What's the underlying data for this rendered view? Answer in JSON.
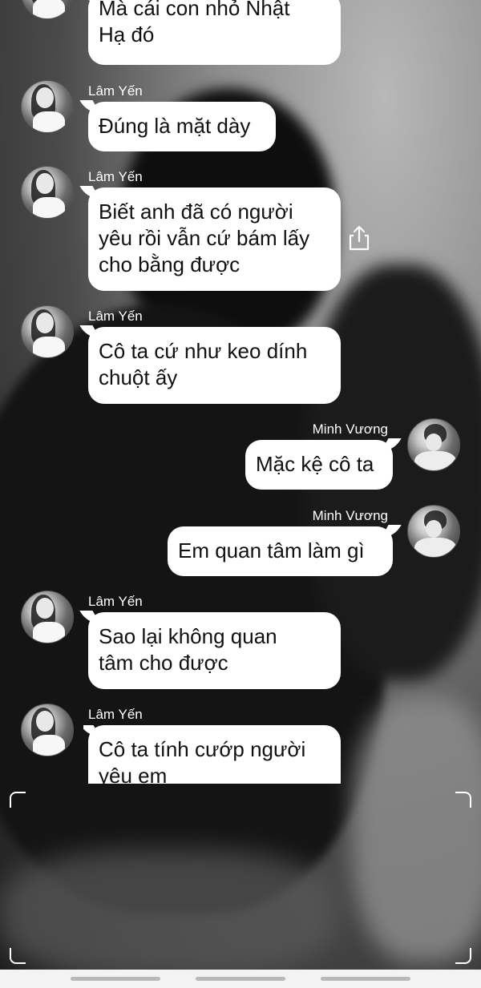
{
  "chat": {
    "messages": [
      {
        "sender": "",
        "side": "left",
        "text": "Mà cái con nhỏ Nhật\nHạ đó"
      },
      {
        "sender": "Lâm Yến",
        "side": "left",
        "text": "Đúng là mặt dày"
      },
      {
        "sender": "Lâm Yến",
        "side": "left",
        "text": "Biết anh đã có người\nyêu rồi vẫn cứ bám lấy\ncho bằng được"
      },
      {
        "sender": "Lâm Yến",
        "side": "left",
        "text": "Cô ta cứ như keo dính\nchuột ấy"
      },
      {
        "sender": "Minh Vương",
        "side": "right",
        "text": "Mặc kệ cô ta"
      },
      {
        "sender": "Minh Vương",
        "side": "right",
        "text": "Em quan tâm làm gì"
      },
      {
        "sender": "Lâm Yến",
        "side": "left",
        "text": "Sao lại không quan\ntâm cho được"
      },
      {
        "sender": "Lâm Yến",
        "side": "left",
        "text": "Cô ta tính cướp người\nyêu em"
      }
    ]
  },
  "icons": {
    "share": "share-icon"
  },
  "colors": {
    "bubble": "#ffffff",
    "text": "#111111",
    "name": "#ffffff"
  }
}
